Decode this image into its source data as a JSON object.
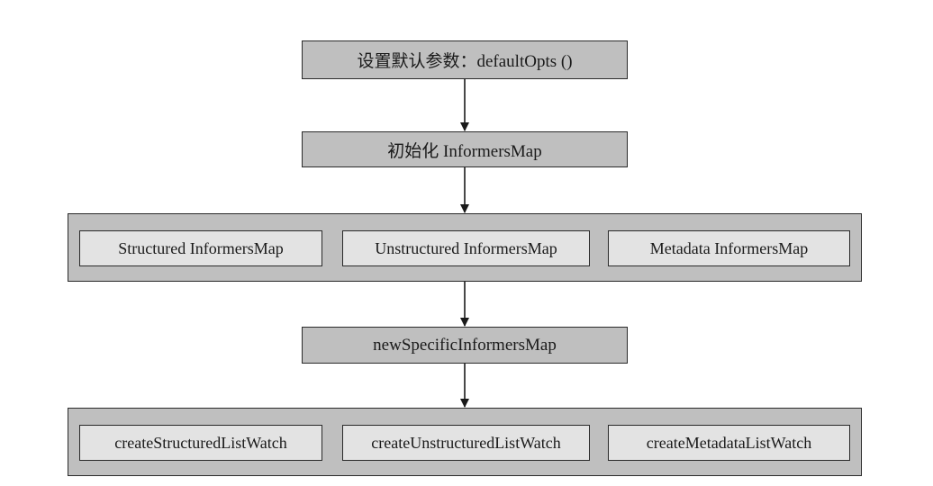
{
  "steps": {
    "default_opts": "设置默认参数：defaultOpts ()",
    "init_informers_map": "初始化 InformersMap",
    "new_specific_informers_map": "newSpecificInformersMap"
  },
  "informers_maps": {
    "structured": "Structured InformersMap",
    "unstructured": "Unstructured InformersMap",
    "metadata": "Metadata InformersMap"
  },
  "list_watches": {
    "structured": "createStructuredListWatch",
    "unstructured": "createUnstructuredListWatch",
    "metadata": "createMetadataListWatch"
  }
}
